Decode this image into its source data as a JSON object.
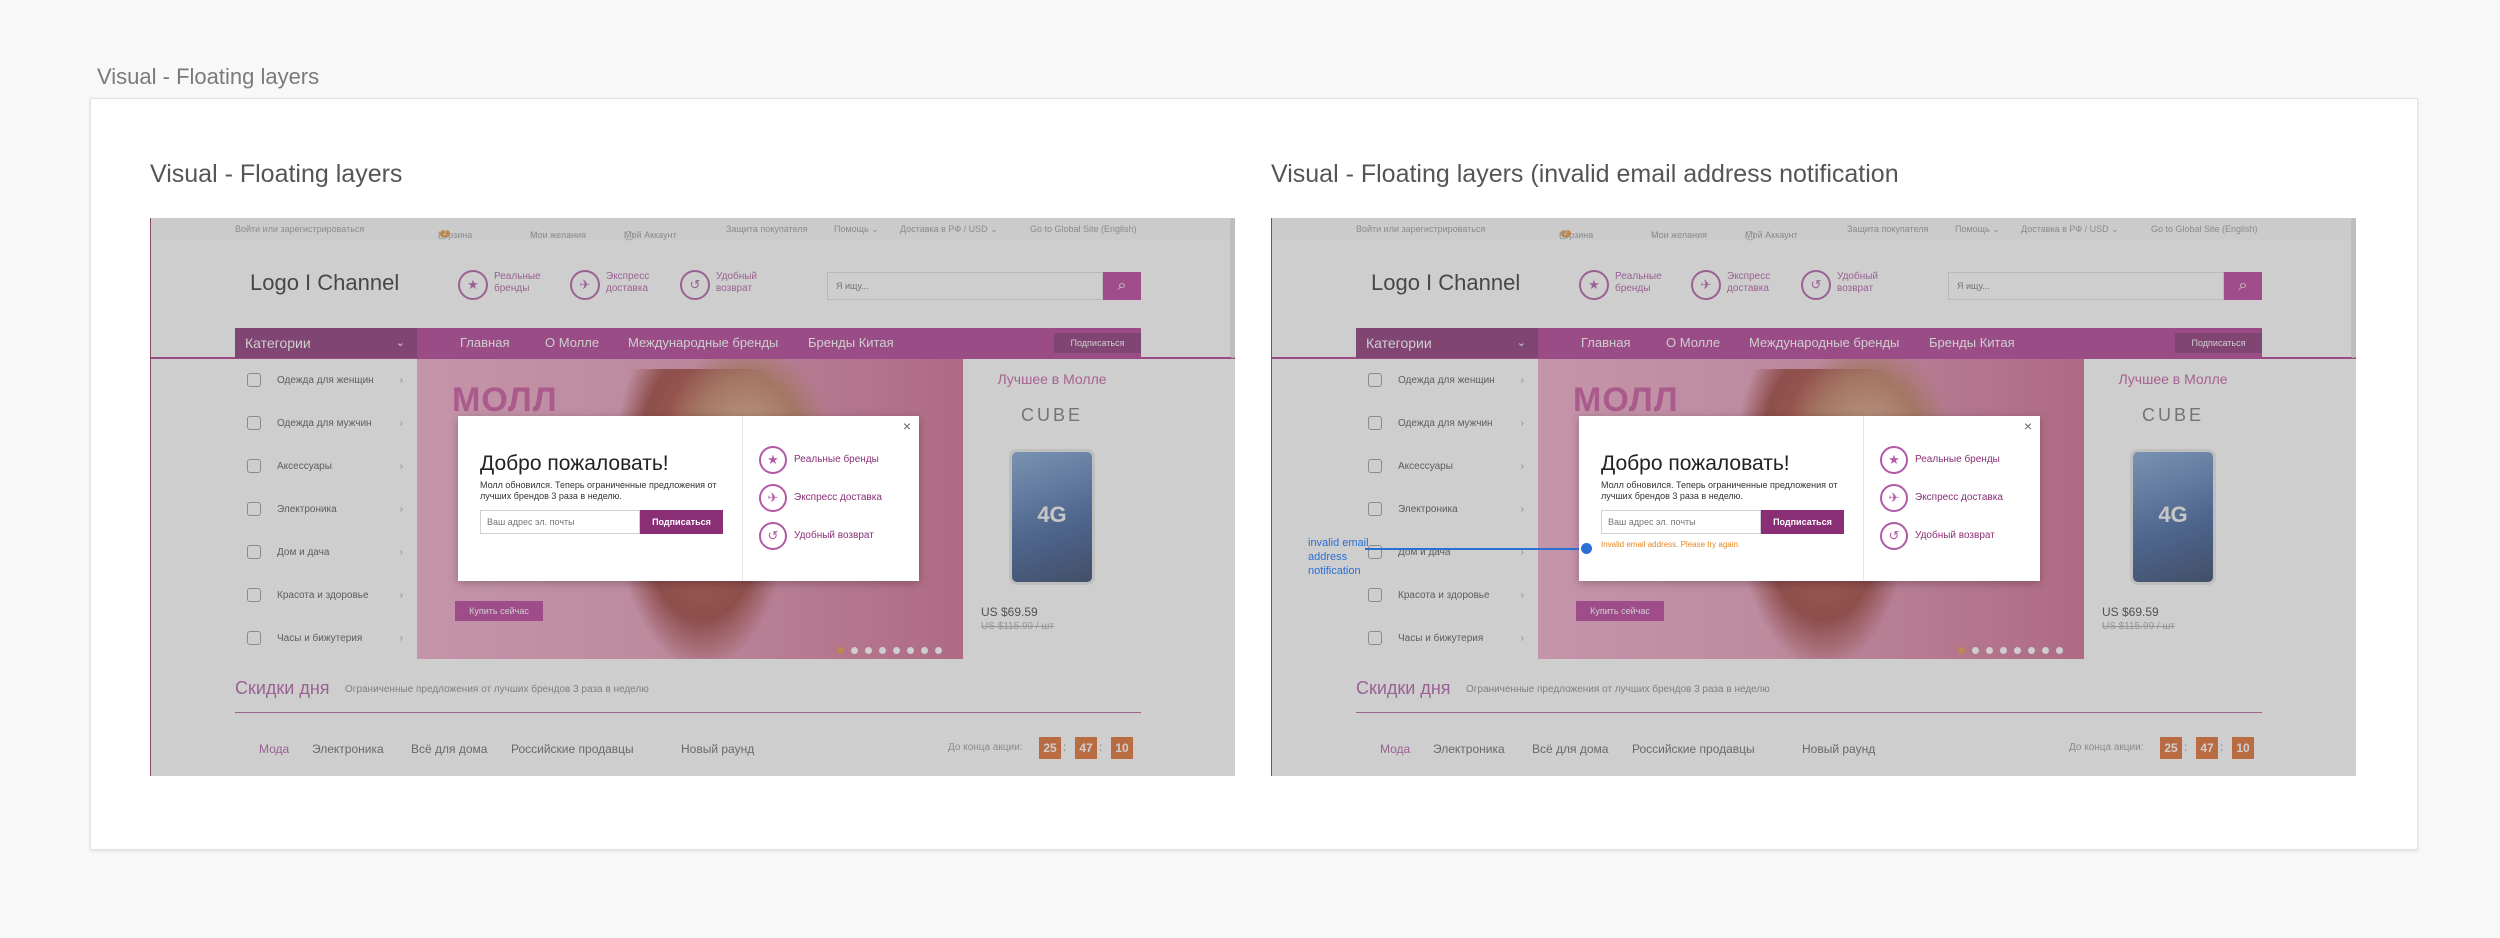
{
  "page": {
    "title": "Visual - Floating layers"
  },
  "panels": [
    {
      "title": "Visual - Floating layers"
    },
    {
      "title": "Visual - Floating layers (invalid email address notification"
    }
  ],
  "site": {
    "topbar": {
      "login": "Войти или зарегистрироваться",
      "cart": "Корзина",
      "cart_count": "2",
      "wishlist": "Мои желания",
      "account": "Мой Аккаунт",
      "protection": "Защита покупателя",
      "help": "Помощь ⌄",
      "delivery": "Доставка в РФ / USD ⌄",
      "global": "Go to Global Site (English)"
    },
    "logo": "Logo I Channel",
    "header_features": [
      {
        "icon": "star-icon",
        "glyph": "★",
        "label": "Реальные бренды"
      },
      {
        "icon": "plane-icon",
        "glyph": "✈",
        "label": "Экспресс доставка"
      },
      {
        "icon": "return-icon",
        "glyph": "↺",
        "label": "Удобный возврат"
      }
    ],
    "search": {
      "placeholder": "Я ищу..."
    },
    "nav": {
      "categories": "Категории",
      "items": [
        "Главная",
        "О Молле",
        "Международные бренды",
        "Бренды Китая"
      ],
      "subscribe": "Подписаться"
    },
    "sidebar": [
      "Одежда для женщин",
      "Одежда для мужчин",
      "Аксессуары",
      "Электроника",
      "Дом и дача",
      "Красота и здоровье",
      "Часы и бижутерия"
    ],
    "banner": {
      "mall": "МОЛЛ",
      "cta": "Купить сейчас"
    },
    "promo": {
      "heading": "Лучшее в Молле",
      "brand": "CUBE",
      "badge": "4G",
      "price": "US $69.59",
      "old_price": "US $115.99 / шт"
    },
    "deals": {
      "title": "Скидки дня",
      "subtitle": "Ограниченные предложения от лучших брендов 3 раза в неделю",
      "tabs": [
        "Мода",
        "Электроника",
        "Всё для дома",
        "Российские продавцы",
        "Новый раунд"
      ],
      "countdown_label": "До конца акции:",
      "countdown": [
        "25",
        "47",
        "10"
      ]
    }
  },
  "modal": {
    "close": "×",
    "title": "Добро пожаловать!",
    "text": "Молл обновился. Теперь ограниченные предложения от лучших брендов 3 раза в неделю.",
    "input_placeholder": "Ваш адрес эл. почты",
    "submit": "Подписаться",
    "error": "Invalid email address. Please try again.",
    "features": [
      {
        "icon": "star-icon",
        "glyph": "★",
        "label": "Реальные бренды"
      },
      {
        "icon": "plane-icon",
        "glyph": "✈",
        "label": "Экспресс доставка"
      },
      {
        "icon": "return-icon",
        "glyph": "↺",
        "label": "Удобный возврат"
      }
    ]
  },
  "annotation": {
    "text": "invalid email address notification"
  },
  "colors": {
    "brand": "#b03a92",
    "brand_dark": "#8a2f76",
    "accent": "#e06a2a",
    "annotation": "#2a6fd6"
  }
}
